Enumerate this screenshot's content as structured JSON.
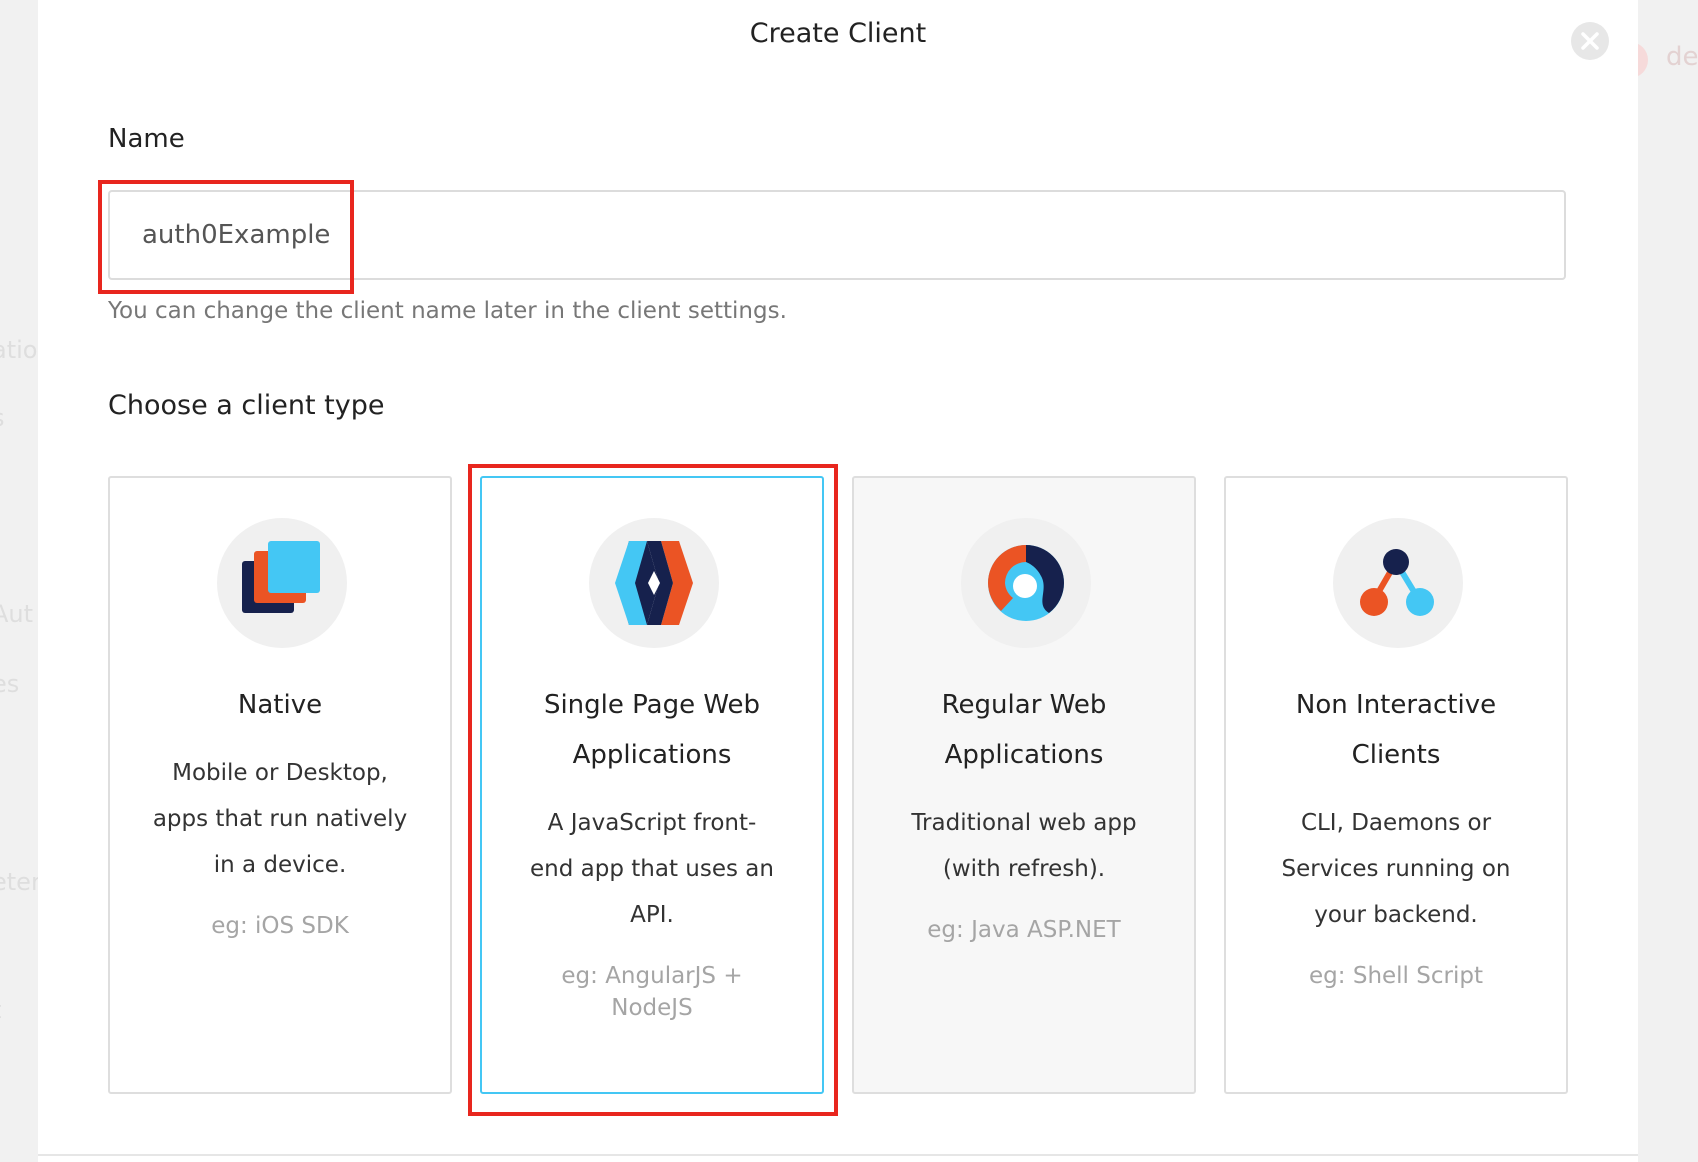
{
  "background": {
    "left_fragments": [
      "atio",
      "s",
      "Aut",
      "es",
      "eter",
      "t"
    ],
    "right_fragment": "de"
  },
  "modal": {
    "title": "Create Client",
    "close_icon": "close-x-icon"
  },
  "name_field": {
    "label": "Name",
    "value": "auth0Example",
    "hint": "You can change the client name later in the client settings."
  },
  "client_type": {
    "label": "Choose a client type",
    "selected": "spa",
    "selected_border_color": "#44c7f4",
    "cards": [
      {
        "id": "native",
        "icon": "native-stacked-squares-icon",
        "title_lines": [
          "Native"
        ],
        "desc_lines": [
          "Mobile or Desktop,",
          "apps that run natively",
          "in a device."
        ],
        "eg_lines": [
          "eg: iOS SDK"
        ]
      },
      {
        "id": "spa",
        "icon": "spa-diamond-icon",
        "title_lines": [
          "Single Page Web",
          "Applications"
        ],
        "desc_lines": [
          "A JavaScript front-",
          "end app that uses an",
          "API."
        ],
        "eg_lines": [
          "eg: AngularJS +",
          "NodeJS"
        ]
      },
      {
        "id": "regular-web",
        "icon": "regular-web-ring-icon",
        "title_lines": [
          "Regular Web",
          "Applications"
        ],
        "desc_lines": [
          "Traditional web app",
          "(with refresh)."
        ],
        "eg_lines": [
          "eg: Java ASP.NET"
        ]
      },
      {
        "id": "non-interactive",
        "icon": "non-interactive-nodes-icon",
        "title_lines": [
          "Non Interactive",
          "Clients"
        ],
        "desc_lines": [
          "CLI, Daemons or",
          "Services running on",
          "your backend."
        ],
        "eg_lines": [
          "eg: Shell Script"
        ]
      }
    ]
  },
  "colors": {
    "annotation_red": "#e8261e",
    "brand_orange": "#eb5424",
    "brand_navy": "#16214d",
    "brand_sky": "#44c7f4"
  }
}
